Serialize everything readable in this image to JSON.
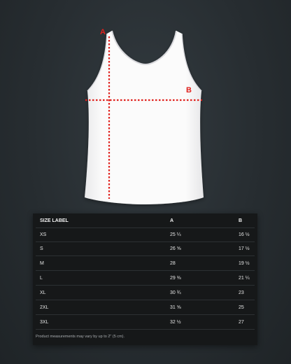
{
  "diagram": {
    "marker_a": "A",
    "marker_b": "B",
    "guide_color": "#e0201c",
    "garment": "tank-top"
  },
  "table": {
    "headers": {
      "label": "SIZE LABEL",
      "a": "A",
      "b": "B"
    },
    "rows": [
      {
        "label": "XS",
        "a": "25 ¼",
        "b": "16 ½"
      },
      {
        "label": "S",
        "a": "26 ⅝",
        "b": "17 ½"
      },
      {
        "label": "M",
        "a": "28",
        "b": "19 ½"
      },
      {
        "label": "L",
        "a": "29 ⅜",
        "b": "21 ¼"
      },
      {
        "label": "XL",
        "a": "30 ¾",
        "b": "23"
      },
      {
        "label": "2XL",
        "a": "31 ⅝",
        "b": "25"
      },
      {
        "label": "3XL",
        "a": "32 ½",
        "b": "27"
      }
    ],
    "note": "Product measurements may vary by up to 2\" (5 cm)."
  }
}
